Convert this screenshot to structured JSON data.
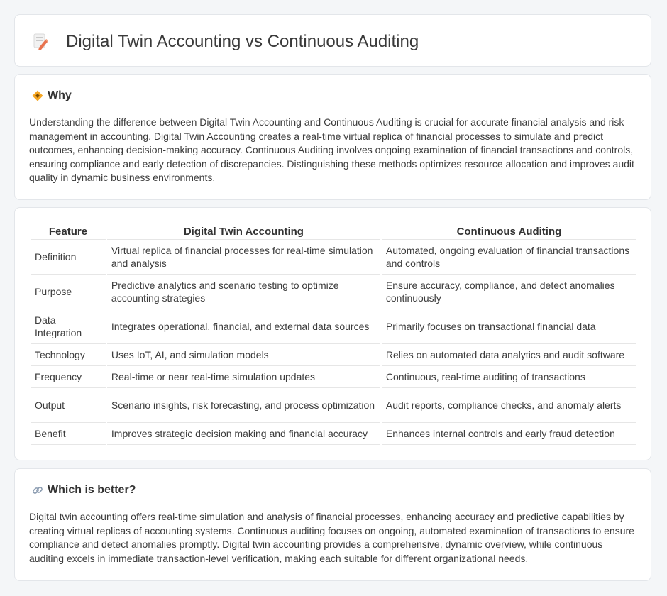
{
  "header": {
    "title": "Digital Twin Accounting vs Continuous Auditing",
    "icon": "document-pencil-icon"
  },
  "why": {
    "icon": "diamond-sign-icon",
    "title": "Why",
    "text": "Understanding the difference between Digital Twin Accounting and Continuous Auditing is crucial for accurate financial analysis and risk management in accounting. Digital Twin Accounting creates a real-time virtual replica of financial processes to simulate and predict outcomes, enhancing decision-making accuracy. Continuous Auditing involves ongoing examination of financial transactions and controls, ensuring compliance and early detection of discrepancies. Distinguishing these methods optimizes resource allocation and improves audit quality in dynamic business environments."
  },
  "table": {
    "headers": [
      "Feature",
      "Digital Twin Accounting",
      "Continuous Auditing"
    ],
    "rows": [
      [
        "Definition",
        "Virtual replica of financial processes for real-time simulation and analysis",
        "Automated, ongoing evaluation of financial transactions and controls"
      ],
      [
        "Purpose",
        "Predictive analytics and scenario testing to optimize accounting strategies",
        "Ensure accuracy, compliance, and detect anomalies continuously"
      ],
      [
        "Data Integration",
        "Integrates operational, financial, and external data sources",
        "Primarily focuses on transactional financial data"
      ],
      [
        "Technology",
        "Uses IoT, AI, and simulation models",
        "Relies on automated data analytics and audit software"
      ],
      [
        "Frequency",
        "Real-time or near real-time simulation updates",
        "Continuous, real-time auditing of transactions"
      ],
      [
        "Output",
        "Scenario insights, risk forecasting, and process optimization",
        "Audit reports, compliance checks, and anomaly alerts"
      ],
      [
        "Benefit",
        "Improves strategic decision making and financial accuracy",
        "Enhances internal controls and early fraud detection"
      ]
    ]
  },
  "better": {
    "icon": "link-icon",
    "title": "Which is better?",
    "text": "Digital twin accounting offers real-time simulation and analysis of financial processes, enhancing accuracy and predictive capabilities by creating virtual replicas of accounting systems. Continuous auditing focuses on ongoing, automated examination of transactions to ensure compliance and detect anomalies promptly. Digital twin accounting provides a comprehensive, dynamic overview, while continuous auditing excels in immediate transaction-level verification, making each suitable for different organizational needs."
  }
}
